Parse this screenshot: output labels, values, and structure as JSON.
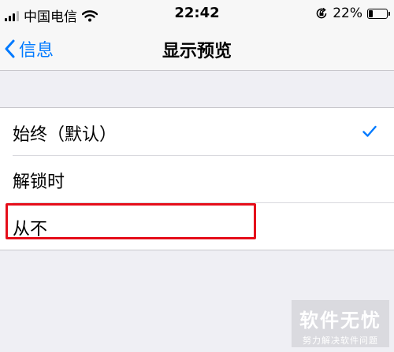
{
  "status_bar": {
    "carrier": "中国电信",
    "time": "22:42",
    "battery_percent": "22%",
    "battery_level": 0.22,
    "icons": [
      "signal-icon",
      "wifi-icon",
      "orientation-lock-icon",
      "battery-icon"
    ]
  },
  "nav": {
    "back_label": "信息",
    "title": "显示预览"
  },
  "options": [
    {
      "label": "始终（默认）",
      "selected": true
    },
    {
      "label": "解锁时",
      "selected": false
    },
    {
      "label": "从不",
      "selected": false
    }
  ],
  "watermark": {
    "title": "软件无忧",
    "subtitle": "努力解决软件问题"
  },
  "colors": {
    "accent": "#007aff",
    "highlight": "#e50e1a",
    "background": "#efeff4"
  }
}
